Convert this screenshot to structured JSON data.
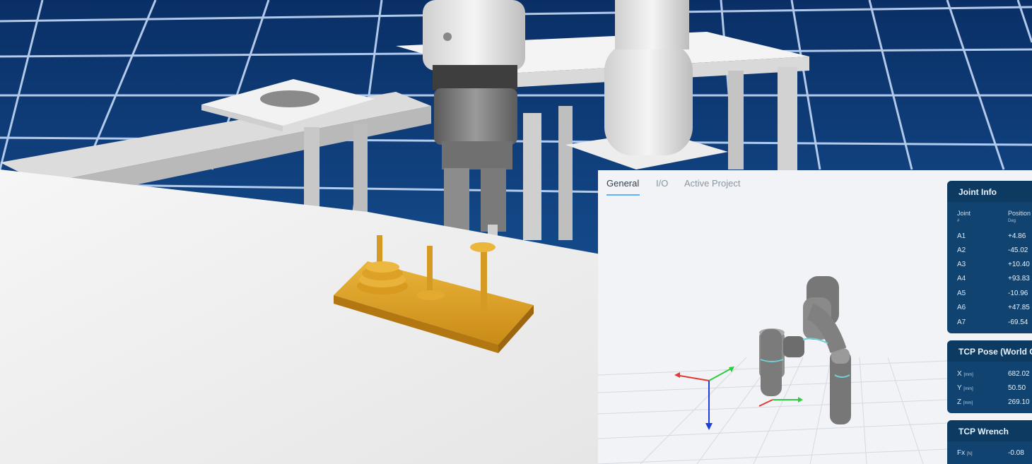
{
  "tabs": [
    {
      "label": "General",
      "active": true
    },
    {
      "label": "I/O",
      "active": false
    },
    {
      "label": "Active Project",
      "active": false
    }
  ],
  "joint_info": {
    "title": "Joint Info",
    "col_joint": "Joint",
    "col_joint_unit": "#",
    "col_position": "Position",
    "col_position_unit": "Deg",
    "rows": [
      {
        "joint": "A1",
        "value": "+4.86"
      },
      {
        "joint": "A2",
        "value": "-45.02"
      },
      {
        "joint": "A3",
        "value": "+10.40"
      },
      {
        "joint": "A4",
        "value": "+93.83"
      },
      {
        "joint": "A5",
        "value": "-10.96"
      },
      {
        "joint": "A6",
        "value": "+47.85"
      },
      {
        "joint": "A7",
        "value": "-69.54"
      }
    ]
  },
  "tcp_pose": {
    "title": "TCP Pose (World C",
    "rows": [
      {
        "axis": "X",
        "unit": "[mm]",
        "value": "682.02"
      },
      {
        "axis": "Y",
        "unit": "[mm]",
        "value": "50.50"
      },
      {
        "axis": "Z",
        "unit": "[mm]",
        "value": "269.10"
      }
    ]
  },
  "tcp_wrench": {
    "title": "TCP Wrench",
    "rows": [
      {
        "axis": "Fx",
        "unit": "[N]",
        "value": "-0.08"
      }
    ]
  },
  "colors": {
    "panel_bg": "#f1f3f6",
    "card_bg": "#10436f",
    "tab_accent": "#5fb1ff",
    "axis_x": "#e53935",
    "axis_y": "#2ecc40",
    "axis_z": "#1e3fd8",
    "floor_blue": "#0b3a78",
    "tower_wood": "#e0a829"
  }
}
